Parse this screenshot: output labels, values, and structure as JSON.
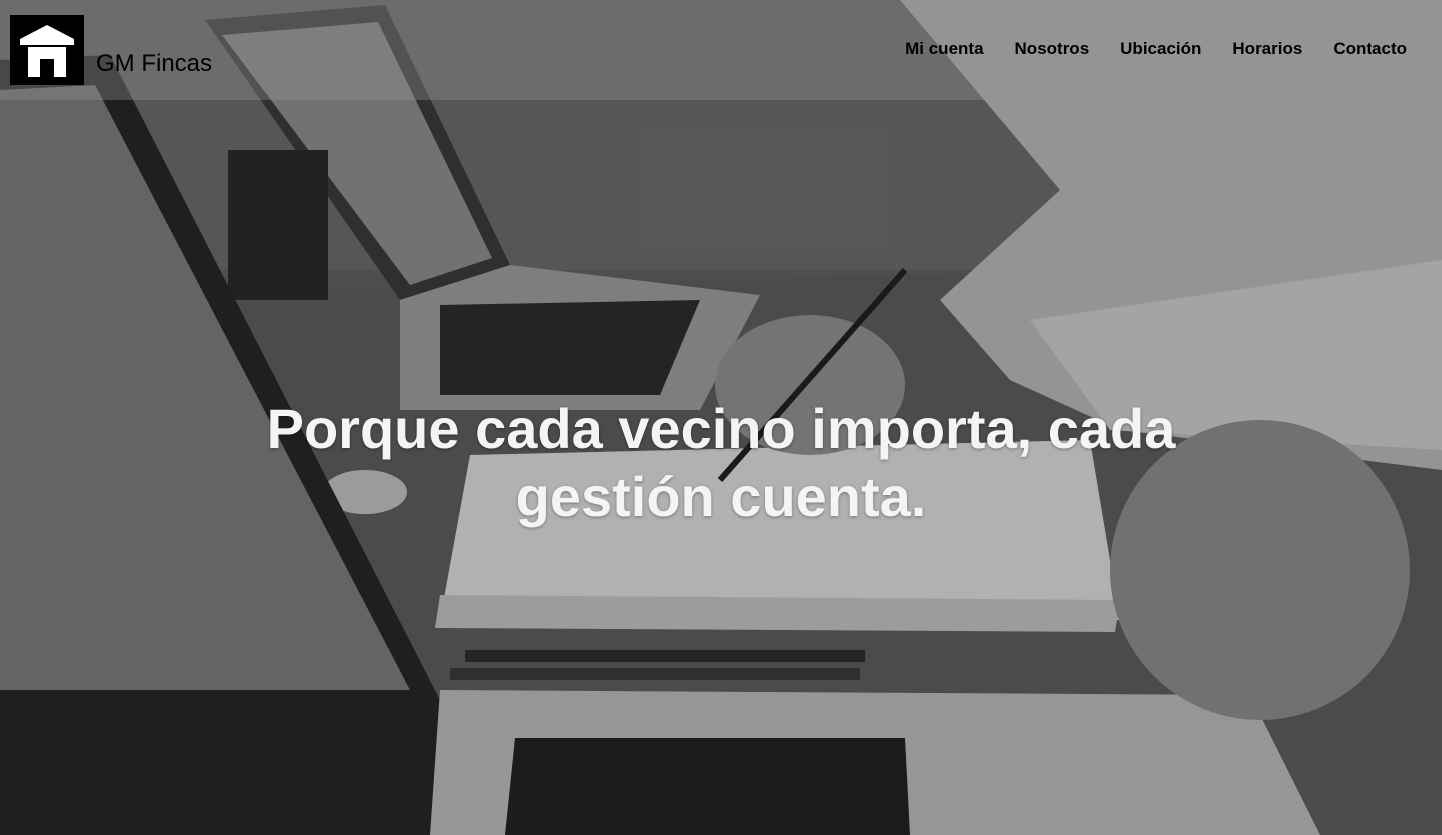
{
  "brand": {
    "name": "GM Fincas",
    "logo_icon": "house-icon"
  },
  "nav": {
    "items": [
      {
        "label": "Mi cuenta"
      },
      {
        "label": "Nosotros"
      },
      {
        "label": "Ubicación"
      },
      {
        "label": "Horarios"
      },
      {
        "label": "Contacto"
      }
    ]
  },
  "hero": {
    "headline": "Porque cada vecino importa, cada gestión cuenta.",
    "background": "grayscale photo of people working at a desk with laptops and documents"
  },
  "colors": {
    "header_text": "#000000",
    "headline_text": "#f4f4f4",
    "logo_bg": "#000000"
  }
}
